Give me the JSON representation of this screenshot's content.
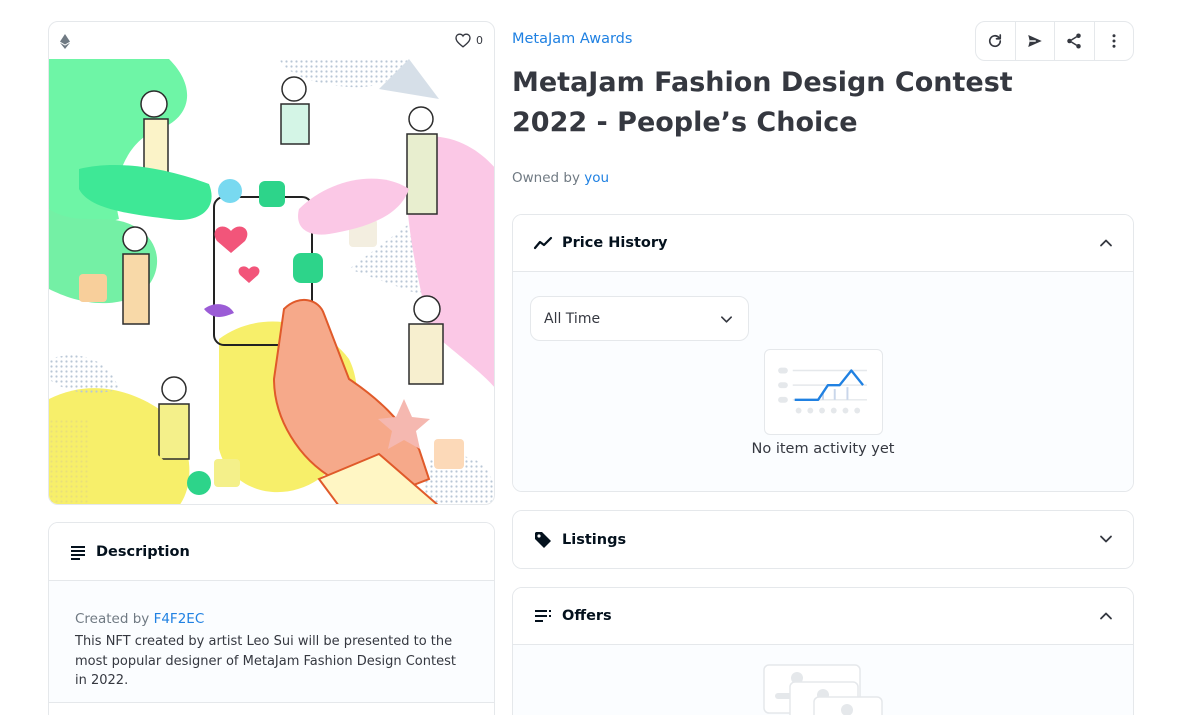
{
  "media": {
    "favorites_count": "0",
    "icons": {
      "chain": "ethereum-icon",
      "favorite": "heart-outline-icon"
    },
    "artwork_alt": "MetaJam Fashion Design Contest 2022 artwork"
  },
  "description": {
    "title": "Description",
    "created_by_label": "Created by",
    "creator": "F4F2EC",
    "text": "This NFT created by artist Leo Sui will be presented to the most popular designer of MetaJam Fashion Design Contest in 2022."
  },
  "item": {
    "collection": "MetaJam Awards",
    "title": "MetaJam Fashion Design Contest 2022 - People’s Choice",
    "owned_by_label": "Owned by",
    "owner": "you"
  },
  "toolbar": {
    "buttons": [
      {
        "name": "refresh-button",
        "icon": "refresh-icon"
      },
      {
        "name": "transfer-button",
        "icon": "send-icon"
      },
      {
        "name": "share-button",
        "icon": "share-icon"
      },
      {
        "name": "more-button",
        "icon": "more-vertical-icon"
      }
    ]
  },
  "price_history": {
    "title": "Price History",
    "range_selected": "All Time",
    "empty_message": "No item activity yet",
    "expanded": true
  },
  "listings": {
    "title": "Listings",
    "expanded": false
  },
  "offers": {
    "title": "Offers",
    "expanded": true
  },
  "colors": {
    "link": "#2081e2",
    "text": "#353840",
    "muted": "#707a83",
    "border": "#e5e8eb",
    "panel_bg": "#fbfdff"
  }
}
